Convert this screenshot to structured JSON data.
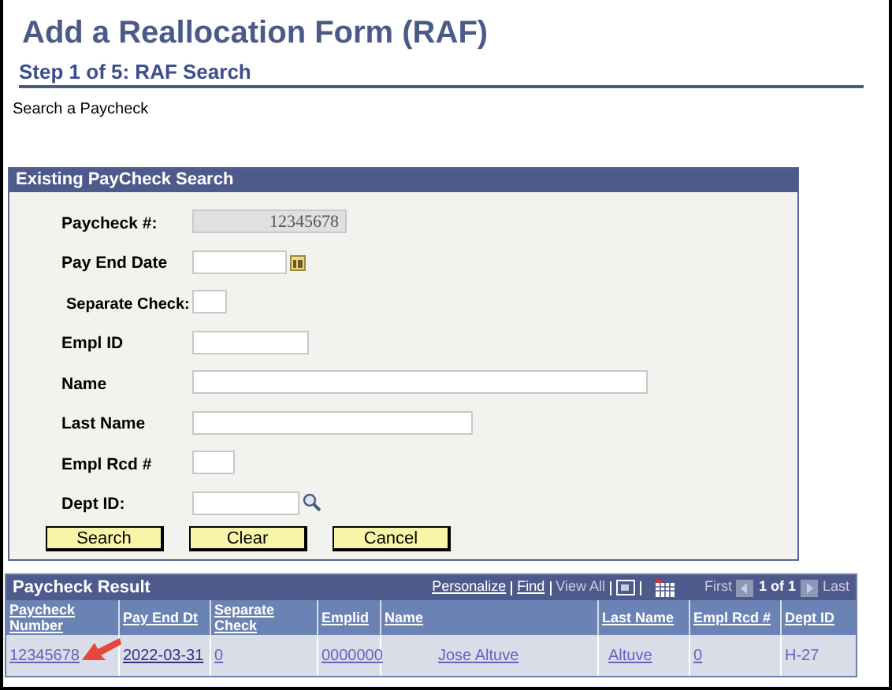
{
  "title": "Add a Reallocation Form (RAF)",
  "step": "Step 1 of 5: RAF Search",
  "subtitle": "Search a Paycheck",
  "search_panel": {
    "title": "Existing PayCheck Search",
    "fields": [
      {
        "label": "Paycheck #:",
        "kind": "text",
        "value": "12345678",
        "disabled": true
      },
      {
        "label": "Pay End Date",
        "kind": "date",
        "disabled": false
      },
      {
        "label": "Separate Check:",
        "kind": "text",
        "disabled": false
      },
      {
        "label": "Empl ID",
        "kind": "text",
        "disabled": false
      },
      {
        "label": "Name",
        "kind": "text",
        "disabled": false
      },
      {
        "label": "Last Name",
        "kind": "text",
        "disabled": false
      },
      {
        "label": "Empl Rcd #",
        "kind": "text",
        "disabled": false
      },
      {
        "label": "Dept ID:",
        "kind": "lookup",
        "disabled": false
      }
    ],
    "buttons": [
      "Search",
      "Clear",
      "Cancel"
    ]
  },
  "results": {
    "title": "Paycheck Result",
    "links": [
      {
        "text": "Personalize",
        "disabled": false
      },
      {
        "text": "Find",
        "disabled": false
      },
      {
        "text": "View All",
        "disabled": true
      }
    ],
    "first": "First",
    "range": "1 of 1",
    "last": "Last",
    "columns": [
      "Paycheck Number",
      "Pay End Dt",
      "Separate Check",
      "Emplid",
      "Name",
      "Last Name",
      "Empl Rcd #",
      "Dept ID"
    ],
    "rows": [
      [
        {
          "text": "12345678",
          "link": true
        },
        {
          "text": "2022-03-31",
          "link": true
        },
        {
          "text": "0",
          "link": true
        },
        {
          "text": "0000000",
          "link": true
        },
        {
          "text": "Jose Altuve",
          "link": true
        },
        {
          "text": "Altuve",
          "link": true
        },
        {
          "text": "0",
          "link": true
        },
        {
          "text": "H-27",
          "link": false
        }
      ]
    ]
  }
}
